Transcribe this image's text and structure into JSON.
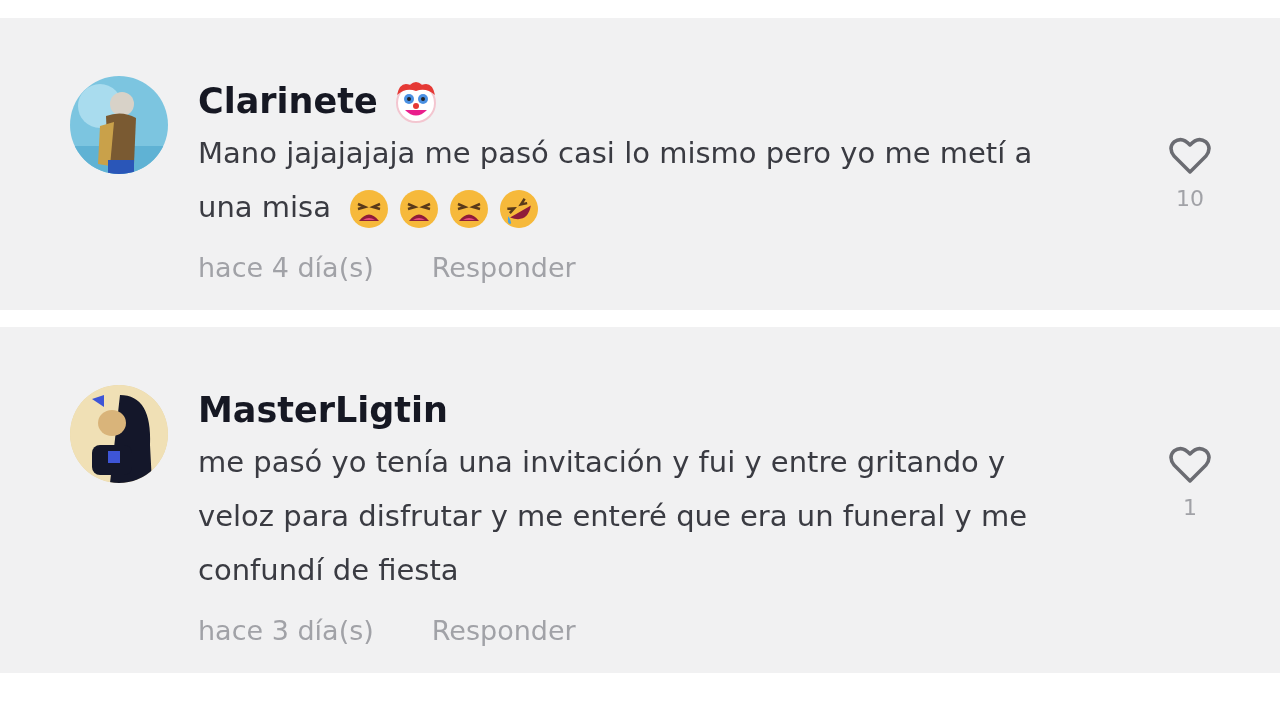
{
  "comments": [
    {
      "author": "Clarinete",
      "author_emojis": [
        {
          "kind": "clown"
        }
      ],
      "text": "Mano jajajajaja me pasó casi lo mismo pero yo me metí a una misa",
      "emojis": [
        {
          "kind": "weary"
        },
        {
          "kind": "weary"
        },
        {
          "kind": "weary"
        },
        {
          "kind": "rofl"
        }
      ],
      "time": "hace 4 día(s)",
      "reply": "Responder",
      "likes": "10",
      "liked": false
    },
    {
      "author": "MasterLigtin",
      "text": "me pasó yo tenía una invitación y fui y entre gritando y veloz para disfrutar y me enteré que era un funeral y me confundí de fiesta",
      "time": "hace 3 día(s)",
      "reply": "Responder",
      "likes": "1",
      "liked": false
    }
  ]
}
